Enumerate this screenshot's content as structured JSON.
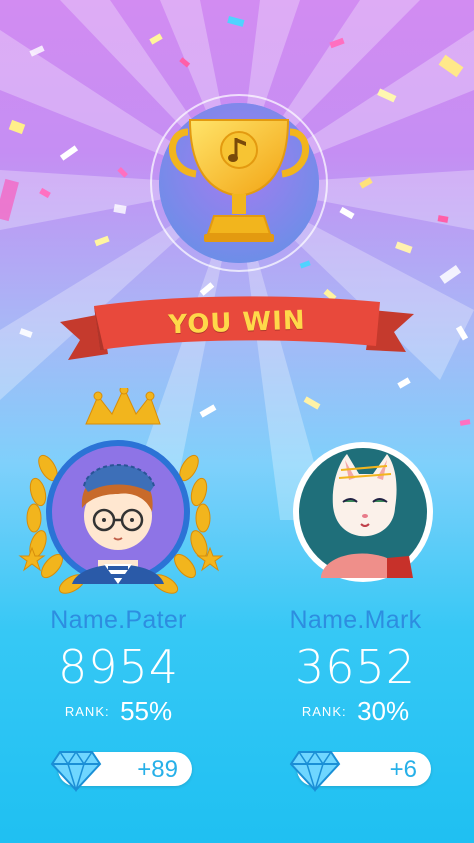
{
  "result": {
    "title": "YOU WIN"
  },
  "players": [
    {
      "name": "Name.Pater",
      "score": "8954",
      "rank_label": "RANK:",
      "rank_value": "55%",
      "gems": "+89"
    },
    {
      "name": "Name.Mark",
      "score": "3652",
      "rank_label": "RANK:",
      "rank_value": "30%",
      "gems": "+6"
    }
  ],
  "icons": {
    "trophy": "trophy-icon",
    "music_note": "music-note-icon",
    "crown": "crown-icon",
    "laurel": "laurel-wreath-icon",
    "gem": "diamond-icon"
  },
  "colors": {
    "name_blue": "#2d8de0",
    "gem_blue": "#27b0e8",
    "banner_red": "#e8493c",
    "banner_text": "#ffd84a",
    "gold": "#f2b51d"
  }
}
